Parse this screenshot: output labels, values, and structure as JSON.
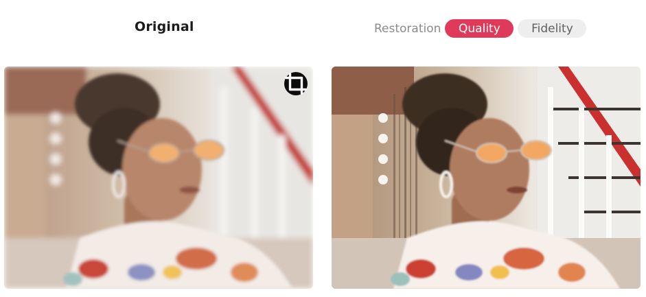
{
  "header": {
    "title": "Original",
    "mode_label": "Restoration",
    "modes": [
      {
        "label": "Quality",
        "active": true
      },
      {
        "label": "Fidelity",
        "active": false
      }
    ]
  },
  "icons": {
    "crop": "crop-icon"
  },
  "colors": {
    "accent": "#e03a5a",
    "inactive_pill": "#eeeeee"
  }
}
